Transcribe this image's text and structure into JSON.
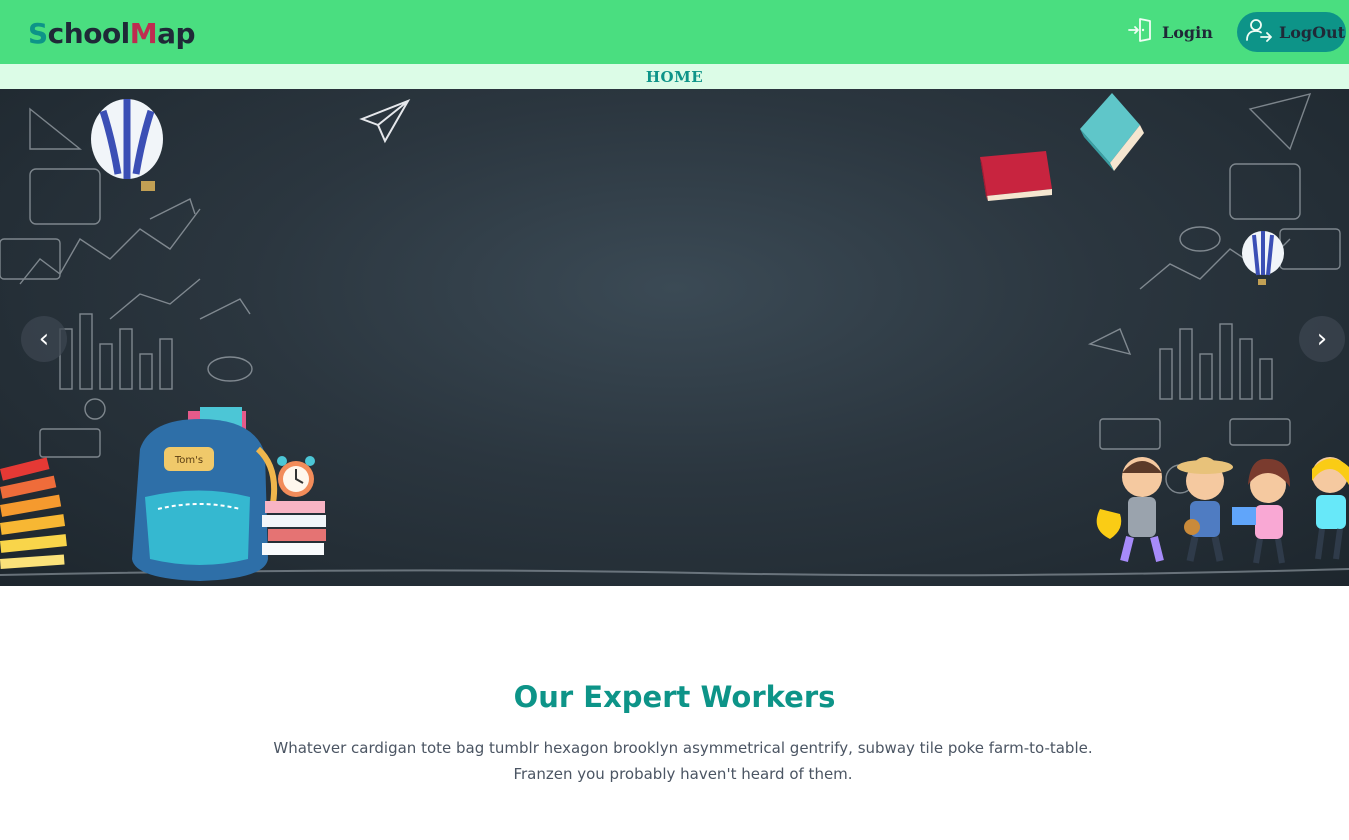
{
  "header": {
    "logo_s": "S",
    "logo_mid": "chool",
    "logo_m": "M",
    "logo_end": "ap",
    "login_label": "Login",
    "logout_label": "LogOut"
  },
  "nav": {
    "items": [
      {
        "label": "HOME"
      }
    ]
  },
  "carousel": {
    "prev_icon": "chevron-left-icon",
    "next_icon": "chevron-right-icon",
    "prev_glyph": "‹",
    "next_glyph": "›",
    "backpack_tag": "Tom's"
  },
  "section": {
    "title": "Our Expert Workers",
    "text": "Whatever cardigan tote bag tumblr hexagon brooklyn asymmetrical gentrify, subway tile poke farm-to-table. Franzen you probably haven't heard of them."
  },
  "colors": {
    "header_bg": "#4ade80",
    "nav_bg": "#dcfce7",
    "accent": "#0d9488",
    "logo_m": "#be2c50"
  }
}
